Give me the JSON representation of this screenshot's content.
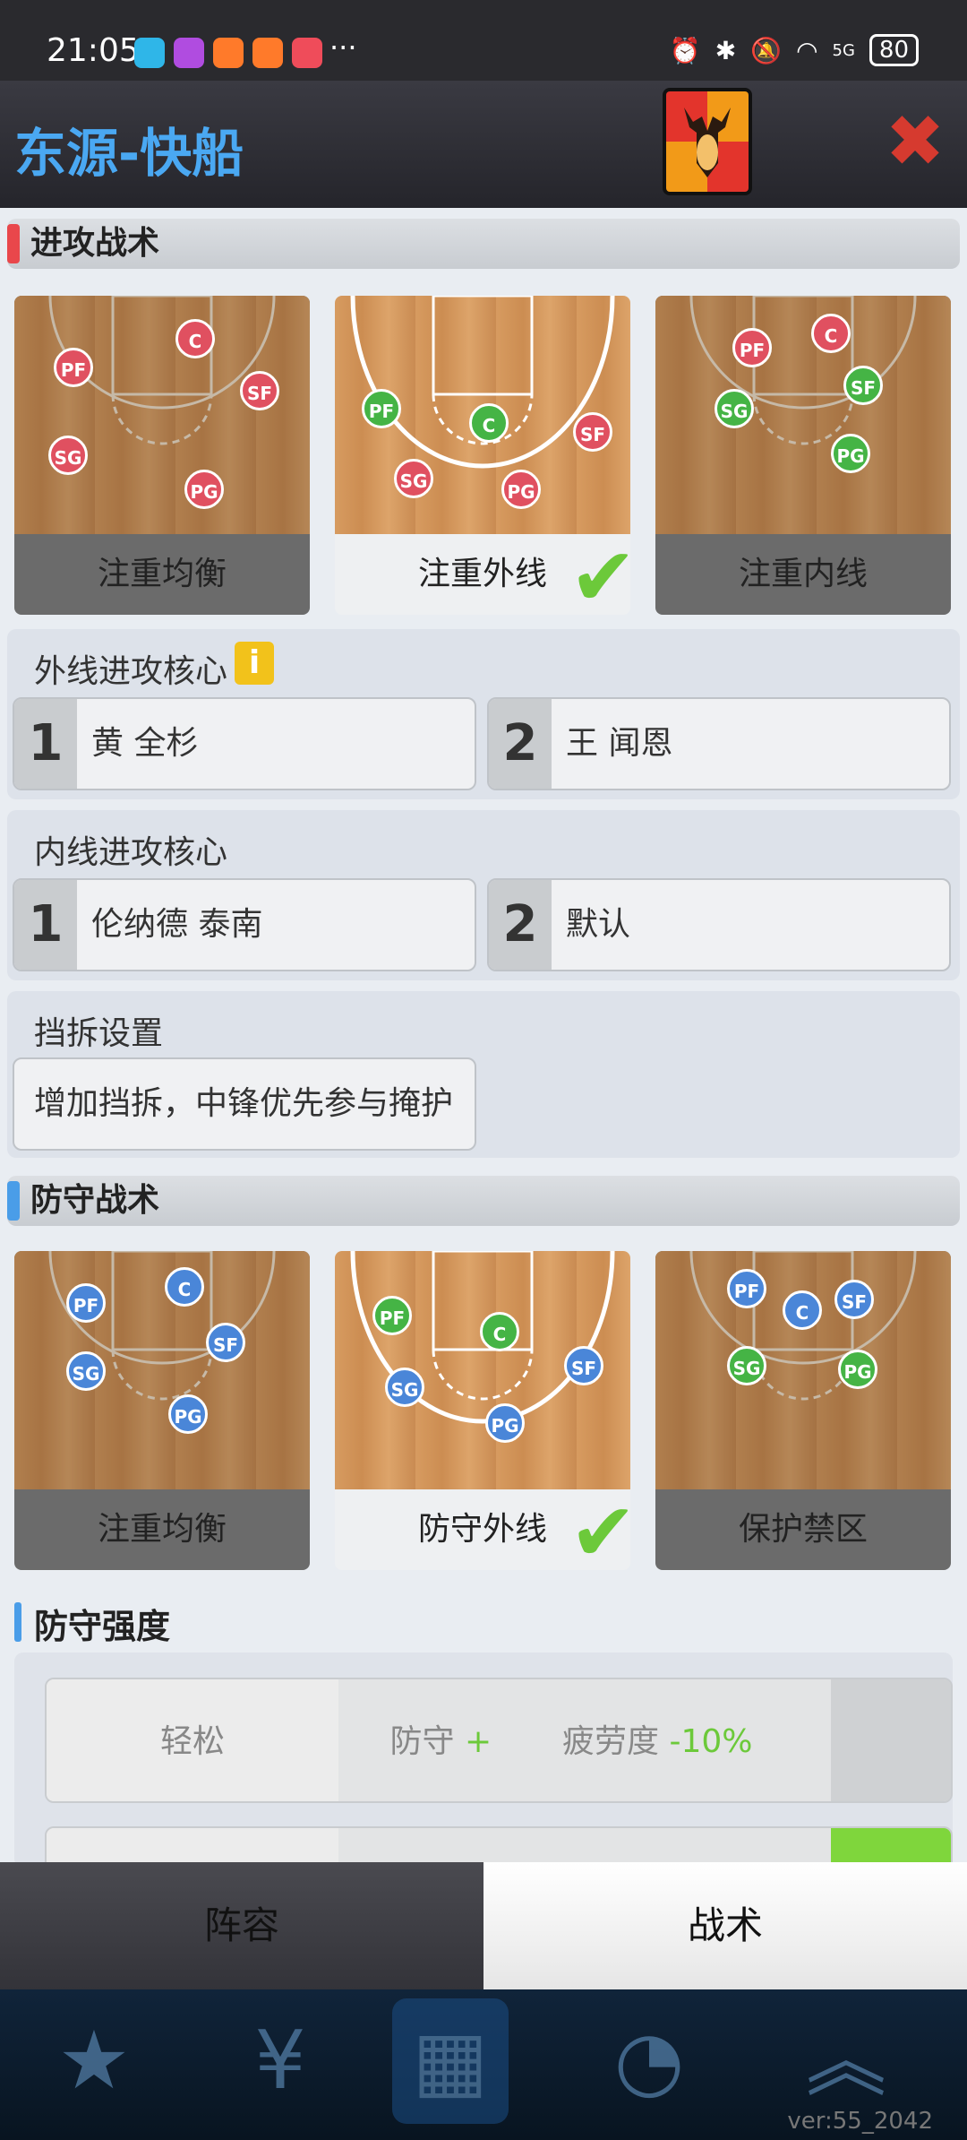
{
  "statusbar": {
    "time": "21:05",
    "dots": "···",
    "battery": "80",
    "network": "5G"
  },
  "header": {
    "title": "东源-快船",
    "close_icon": "✖"
  },
  "offense": {
    "section_title": "进攻战术",
    "cards": [
      {
        "label": "注重均衡",
        "players": [
          "PF",
          "C",
          "SF",
          "SG",
          "PG"
        ]
      },
      {
        "label": "注重外线",
        "players": [
          "PF",
          "C",
          "SF",
          "SG",
          "PG"
        ]
      },
      {
        "label": "注重内线",
        "players": [
          "PF",
          "C",
          "SF",
          "SG",
          "PG"
        ]
      }
    ],
    "selected": 1
  },
  "perimeter_core": {
    "title": "外线进攻核心",
    "slot1": {
      "num": "1",
      "name": "黄 全杉"
    },
    "slot2": {
      "num": "2",
      "name": "王 闻恩"
    }
  },
  "interior_core": {
    "title": "内线进攻核心",
    "slot1": {
      "num": "1",
      "name": "伦纳德 泰南"
    },
    "slot2": {
      "num": "2",
      "name": "默认"
    }
  },
  "screen": {
    "title": "挡拆设置",
    "value": "增加挡拆，中锋优先参与掩护"
  },
  "defense": {
    "section_title": "防守战术",
    "cards": [
      {
        "label": "注重均衡",
        "players": [
          "PF",
          "C",
          "SF",
          "SG",
          "PG"
        ]
      },
      {
        "label": "防守外线",
        "players": [
          "PF",
          "C",
          "SF",
          "SG",
          "PG"
        ]
      },
      {
        "label": "保护禁区",
        "players": [
          "PF",
          "C",
          "SF",
          "SG",
          "PG"
        ]
      }
    ],
    "selected": 1
  },
  "intensity": {
    "title": "防守强度",
    "left": "轻松",
    "defense_label": "防守",
    "defense_value": "+",
    "fatigue_label": "疲劳度",
    "fatigue_value": "-10%"
  },
  "tabs": {
    "lineup": "阵容",
    "tactics": "战术"
  },
  "version": "ver:55_2042",
  "colors": {
    "title_blue": "#4aa8f2",
    "check_green": "#6cc93a",
    "close_red": "#d63a2f"
  }
}
